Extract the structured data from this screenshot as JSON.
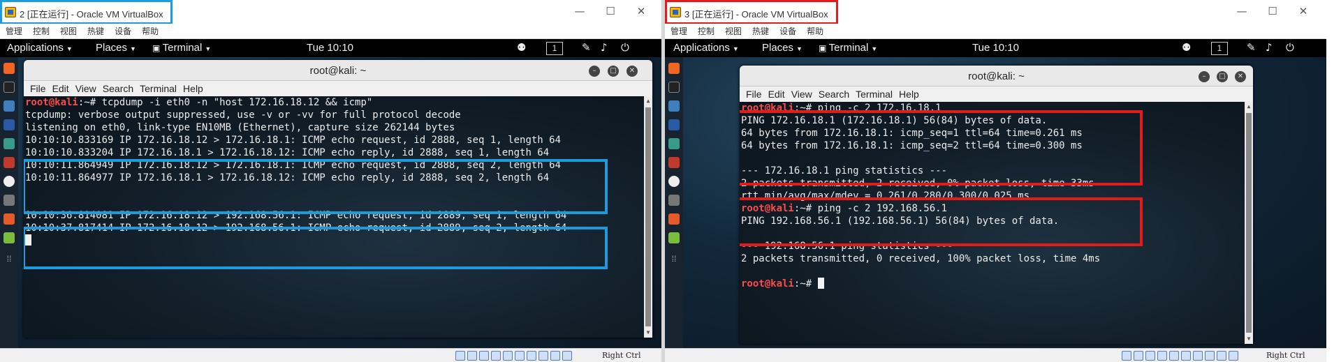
{
  "colors": {
    "highlight_blue": "#1e9bdc",
    "highlight_red": "#e21b1b",
    "prompt_red": "#ff4a4a"
  },
  "vm_menu": [
    "管理",
    "控制",
    "视图",
    "热键",
    "设备",
    "帮助"
  ],
  "window_controls": {
    "minimize": "—",
    "maximize": "☐",
    "close": "✕"
  },
  "gnome": {
    "applications": "Applications",
    "places": "Places",
    "terminal": "Terminal",
    "workspace": "1"
  },
  "tray_icons": [
    "accessibility-icon",
    "pen-icon",
    "volume-icon",
    "power-icon"
  ],
  "status": {
    "host_key": "Right Ctrl"
  },
  "terminal_menu": [
    "File",
    "Edit",
    "View",
    "Search",
    "Terminal",
    "Help"
  ],
  "vm2": {
    "title": "2 [正在运行] - Oracle VM VirtualBox",
    "clock": "Tue 10:10",
    "terminal_title": "root@kali: ~",
    "prompt_user": "root@kali",
    "prompt_path": ":~# ",
    "command": "tcpdump -i eth0 -n \"host 172.16.18.12 && icmp\"",
    "lines": [
      "tcpdump: verbose output suppressed, use -v or -vv for full protocol decode",
      "listening on eth0, link-type EN10MB (Ethernet), capture size 262144 bytes",
      "10:10:10.833169 IP 172.16.18.12 > 172.16.18.1: ICMP echo request, id 2888, seq 1, length 64",
      "10:10:10.833204 IP 172.16.18.1 > 172.16.18.12: ICMP echo reply, id 2888, seq 1, length 64",
      "10:10:11.864949 IP 172.16.18.12 > 172.16.18.1: ICMP echo request, id 2888, seq 2, length 64",
      "10:10:11.864977 IP 172.16.18.1 > 172.16.18.12: ICMP echo reply, id 2888, seq 2, length 64",
      "",
      "",
      "10:10:36.814081 IP 172.16.18.12 > 192.168.56.1: ICMP echo request, id 2889, seq 1, length 64",
      "10:10:37.817414 IP 172.16.18.12 > 192.168.56.1: ICMP echo request, id 2889, seq 2, length 64"
    ]
  },
  "vm3": {
    "title": "3 [正在运行] - Oracle VM VirtualBox",
    "clock": "Tue 10:10",
    "terminal_title": "root@kali: ~",
    "prompt_user": "root@kali",
    "prompt_path": ":~# ",
    "command1": "ping -c 2 172.16.18.1",
    "block1": [
      "PING 172.16.18.1 (172.16.18.1) 56(84) bytes of data.",
      "64 bytes from 172.16.18.1: icmp_seq=1 ttl=64 time=0.261 ms",
      "64 bytes from 172.16.18.1: icmp_seq=2 ttl=64 time=0.300 ms",
      "",
      "--- 172.16.18.1 ping statistics ---",
      "2 packets transmitted, 2 received, 0% packet loss, time 33ms",
      "rtt min/avg/max/mdev = 0.261/0.280/0.300/0.025 ms"
    ],
    "command2": "ping -c 2 192.168.56.1",
    "block2": [
      "PING 192.168.56.1 (192.168.56.1) 56(84) bytes of data.",
      "",
      "--- 192.168.56.1 ping statistics ---",
      "2 packets transmitted, 0 received, 100% packet loss, time 4ms"
    ]
  }
}
